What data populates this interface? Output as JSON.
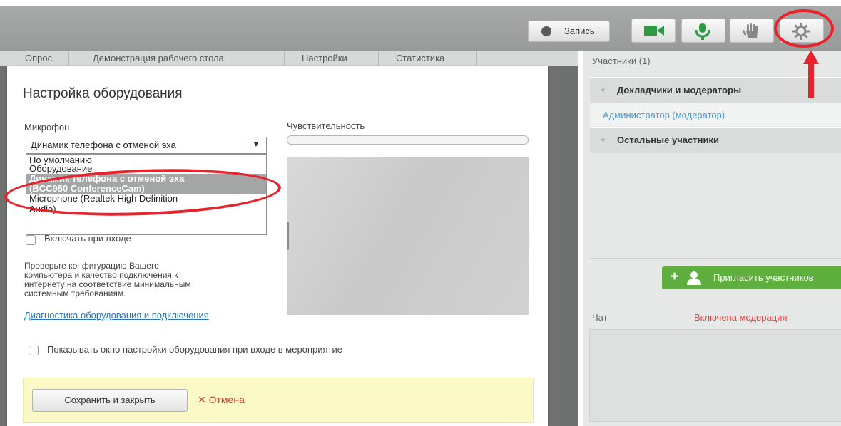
{
  "toolbar": {
    "record_label": "Запись",
    "buttons": [
      {
        "icon": "camera-icon",
        "color": "#3aa84a"
      },
      {
        "icon": "microphone-icon",
        "color": "#3aa84a"
      },
      {
        "icon": "raise-hand-icon",
        "color": "#8c8c8c"
      },
      {
        "icon": "gear-icon",
        "color": "#8c8c8c"
      }
    ]
  },
  "tabs": [
    "Опрос",
    "Демонстрация рабочего стола",
    "Настройки",
    "Статистика"
  ],
  "dialog": {
    "title": "Настройка оборудования",
    "mic_label": "Микрофон",
    "sensitivity_label": "Чувствительность",
    "selected_device": "Динамик телефона с отменой эха",
    "options": [
      "По умолчанию",
      "Оборудование",
      "Динамик телефона с отменой эха",
      "(BCC950 ConferenceCam)",
      "Microphone (Realtek High Definition",
      "Audio)"
    ],
    "enable_on_entry": "Включать при входе",
    "info_lines": [
      "Проверьте конфигурацию Вашего",
      "компьютера и качество подключения к",
      "интернету на соответствие минимальным",
      "системным требованиям."
    ],
    "diagnostics_link": "Диагностика оборудования и подключения",
    "show_on_entry": "Показывать окно настройки оборудования при входе в мероприятие",
    "save_button": "Сохранить и закрыть",
    "cancel_button": "Отмена",
    "cancel_mark": "✕"
  },
  "participants": {
    "title": "Участники (1)",
    "section_presenters": "Докладчики и модераторы",
    "presenter": "Администратор (модератор)",
    "section_others": "Остальные участники",
    "invite_button": "Пригласить участников"
  },
  "chat": {
    "title": "Чат",
    "moderation_status": "Включена модерация"
  },
  "colors": {
    "annotation_red": "#e8232b",
    "accent_green": "#5faf3f",
    "link_blue": "#2a74b8"
  }
}
